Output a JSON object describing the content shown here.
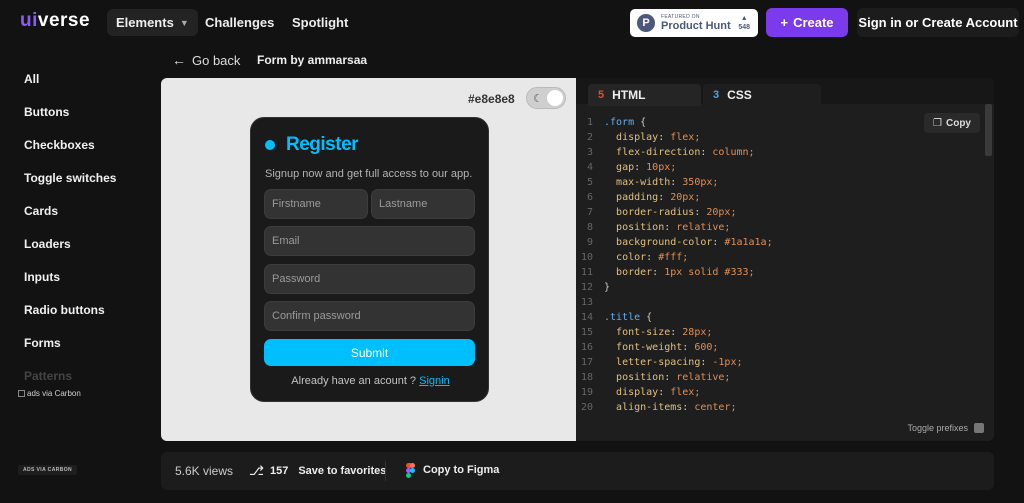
{
  "header": {
    "logo_prefix": "ui",
    "logo_suffix": "verse",
    "nav": {
      "elements": "Elements",
      "challenges": "Challenges",
      "spotlight": "Spotlight"
    },
    "product_hunt": {
      "small": "FEATURED ON",
      "name": "Product Hunt",
      "count": "548"
    },
    "create": "Create",
    "signin": "Sign in or Create Account"
  },
  "sidebar": {
    "items": [
      "All",
      "Buttons",
      "Checkboxes",
      "Toggle switches",
      "Cards",
      "Loaders",
      "Inputs",
      "Radio buttons",
      "Forms",
      "Patterns"
    ],
    "ad_text": "ads via Carbon",
    "ad_link": "ADS VIA CARBON"
  },
  "breadcrumb": {
    "back": "Go back",
    "title": "Form by ammarsaa"
  },
  "preview": {
    "bg_hex": "#e8e8e8",
    "form": {
      "title": "Register",
      "message": "Signup now and get full access to our app.",
      "firstname": "Firstname",
      "lastname": "Lastname",
      "email": "Email",
      "password": "Password",
      "confirm": "Confirm password",
      "submit": "Submit",
      "signin_text": "Already have an acount ?",
      "signin_link": "Signin"
    }
  },
  "code": {
    "tab_html": "HTML",
    "tab_css": "CSS",
    "copy": "Copy",
    "toggle_prefixes": "Toggle prefixes",
    "lines": [
      {
        "n": "1",
        "t": ".form {"
      },
      {
        "n": "2",
        "t": "  display: flex;"
      },
      {
        "n": "3",
        "t": "  flex-direction: column;"
      },
      {
        "n": "4",
        "t": "  gap: 10px;"
      },
      {
        "n": "5",
        "t": "  max-width: 350px;"
      },
      {
        "n": "6",
        "t": "  padding: 20px;"
      },
      {
        "n": "7",
        "t": "  border-radius: 20px;"
      },
      {
        "n": "8",
        "t": "  position: relative;"
      },
      {
        "n": "9",
        "t": "  background-color: #1a1a1a;"
      },
      {
        "n": "10",
        "t": "  color: #fff;"
      },
      {
        "n": "11",
        "t": "  border: 1px solid #333;"
      },
      {
        "n": "12",
        "t": "}"
      },
      {
        "n": "13",
        "t": ""
      },
      {
        "n": "14",
        "t": ".title {"
      },
      {
        "n": "15",
        "t": "  font-size: 28px;"
      },
      {
        "n": "16",
        "t": "  font-weight: 600;"
      },
      {
        "n": "17",
        "t": "  letter-spacing: -1px;"
      },
      {
        "n": "18",
        "t": "  position: relative;"
      },
      {
        "n": "19",
        "t": "  display: flex;"
      },
      {
        "n": "20",
        "t": "  align-items: center;"
      }
    ]
  },
  "footer": {
    "views": "5.6K views",
    "favorites_count": "157",
    "favorites_label": "Save to favorites",
    "figma": "Copy to Figma"
  },
  "colors": {
    "accent": "#00bfff",
    "brand": "#7c3aed"
  }
}
